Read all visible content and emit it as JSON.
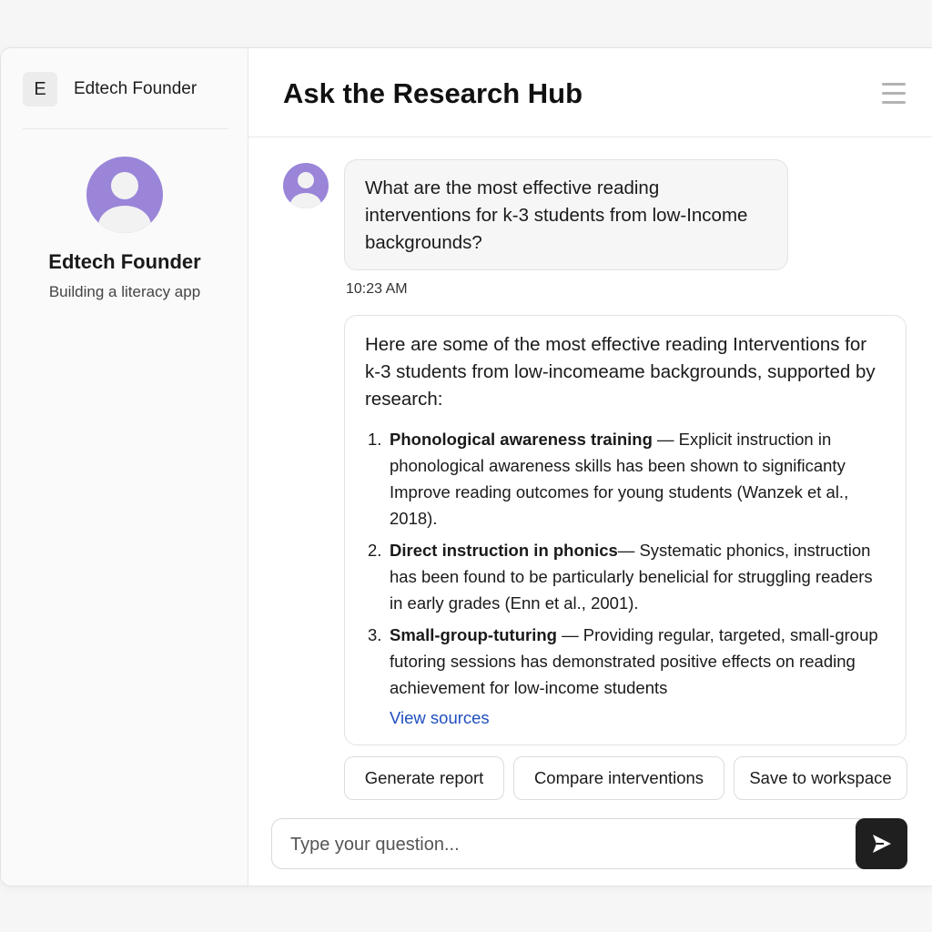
{
  "workspace": {
    "badge_letter": "E",
    "name": "Edtech Founder"
  },
  "profile": {
    "name": "Edtech Founder",
    "subtitle": "Building a literacy app",
    "avatar_icon": "person-avatar-icon"
  },
  "header": {
    "title": "Ask the Research Hub",
    "menu_icon": "hamburger-menu-icon"
  },
  "conversation": {
    "user_message": {
      "text": "What are the most effective reading interventions for k-3 students from low-Income backgrounds?",
      "timestamp": "10:23 AM"
    },
    "ai_response": {
      "intro": "Here are some of the most effective reading Interventions for k-3 students from low-incomeame backgrounds, supported by research:",
      "items": [
        {
          "number": "1.",
          "term": "Phonological awareness training",
          "separator": " — ",
          "detail": "Explicit instruction in phonological awareness skills has been shown to significanty Improve reading outcomes for young students (Wanzek et al., 2018)."
        },
        {
          "number": "2.",
          "term": "Direct instruction in phonics",
          "separator": "— ",
          "detail": "Systematic phonics, instruction has been found to be particularly benelicial for struggling readers in early grades (Enn et al., 2001)."
        },
        {
          "number": "3.",
          "term": "Small-group-tuturing",
          "separator": " — ",
          "detail": "Providing regular, targeted, small-group futoring sessions has demonstrated positive effects on reading achievement for low-income students"
        }
      ],
      "view_sources_label": "View sources"
    }
  },
  "actions": {
    "generate_report": "Generate report",
    "compare_interventions": "Compare interventions",
    "save_to_workspace": "Save to workspace"
  },
  "composer": {
    "placeholder": "Type your question...",
    "value": "",
    "send_icon": "send-arrow-icon"
  },
  "colors": {
    "avatar_purple": "#9a85d9",
    "link_blue": "#1f4fbf",
    "send_button": "#1f1f1f"
  }
}
